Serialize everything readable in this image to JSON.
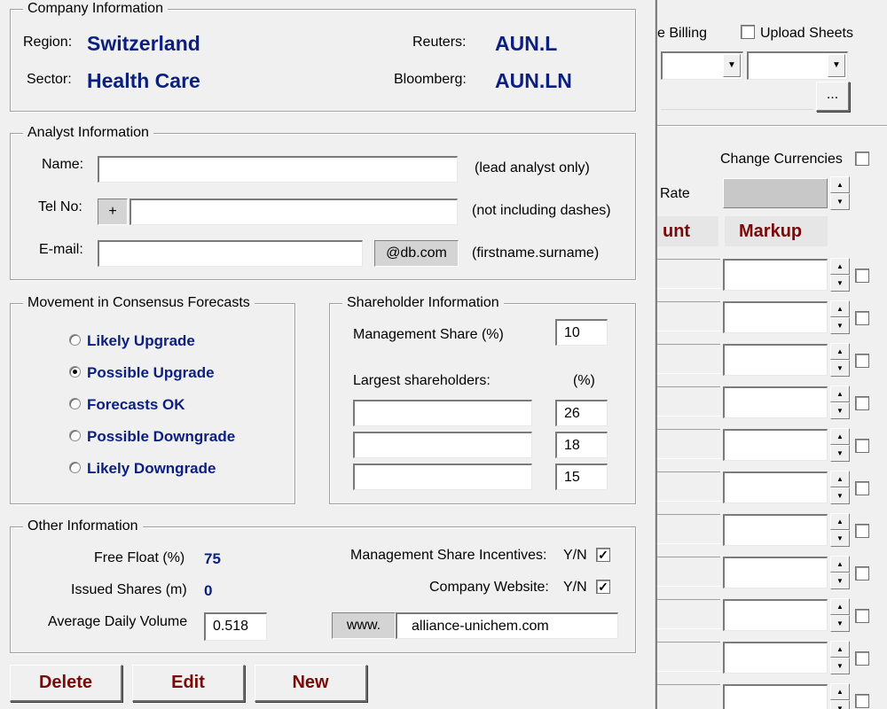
{
  "company": {
    "legend": "Company Information",
    "region_label": "Region:",
    "region_value": "Switzerland",
    "sector_label": "Sector:",
    "sector_value": "Health Care",
    "reuters_label": "Reuters:",
    "reuters_value": "AUN.L",
    "bloomberg_label": "Bloomberg:",
    "bloomberg_value": "AUN.LN"
  },
  "analyst": {
    "legend": "Analyst Information",
    "name_label": "Name:",
    "name_value": "",
    "name_hint": "(lead analyst only)",
    "tel_label": "Tel No:",
    "tel_prefix": "+",
    "tel_value": "",
    "tel_hint": "(not including dashes)",
    "email_label": "E-mail:",
    "email_value": "",
    "email_domain": "@db.com",
    "email_hint": "(firstname.surname)"
  },
  "movement": {
    "legend": "Movement in Consensus Forecasts",
    "options": [
      {
        "label": "Likely Upgrade",
        "selected": false
      },
      {
        "label": "Possible Upgrade",
        "selected": true
      },
      {
        "label": "Forecasts OK",
        "selected": false
      },
      {
        "label": "Possible Downgrade",
        "selected": false
      },
      {
        "label": "Likely Downgrade",
        "selected": false
      }
    ]
  },
  "shareholder": {
    "legend": "Shareholder Information",
    "mgmt_label": "Management Share (%)",
    "mgmt_value": "10",
    "largest_label": "Largest shareholders:",
    "pct_label": "(%)",
    "rows": [
      {
        "name": "",
        "pct": "26"
      },
      {
        "name": "",
        "pct": "18"
      },
      {
        "name": "",
        "pct": "15"
      }
    ]
  },
  "other": {
    "legend": "Other Information",
    "free_float_label": "Free Float (%)",
    "free_float_value": "75",
    "issued_label": "Issued Shares (m)",
    "issued_value": "0",
    "adv_label": "Average Daily Volume",
    "adv_value": "0.518",
    "incentives_label": "Management Share Incentives:",
    "incentives_yn": "Y/N",
    "incentives_checked": true,
    "website_label": "Company Website:",
    "website_yn": "Y/N",
    "website_checked": true,
    "www_prefix": "www.",
    "website_value": "alliance-unichem.com"
  },
  "buttons": {
    "delete": "Delete",
    "edit": "Edit",
    "new": "New"
  },
  "right_panel": {
    "billing_label": "e Billing",
    "upload_label": "Upload Sheets",
    "browse_label": "...",
    "change_currencies_label": "Change Currencies",
    "rate_label": "Rate",
    "amount_header": "unt",
    "markup_header": "Markup"
  },
  "colors": {
    "value_blue": "#0b1f7e",
    "button_red": "#7a0a0a"
  }
}
